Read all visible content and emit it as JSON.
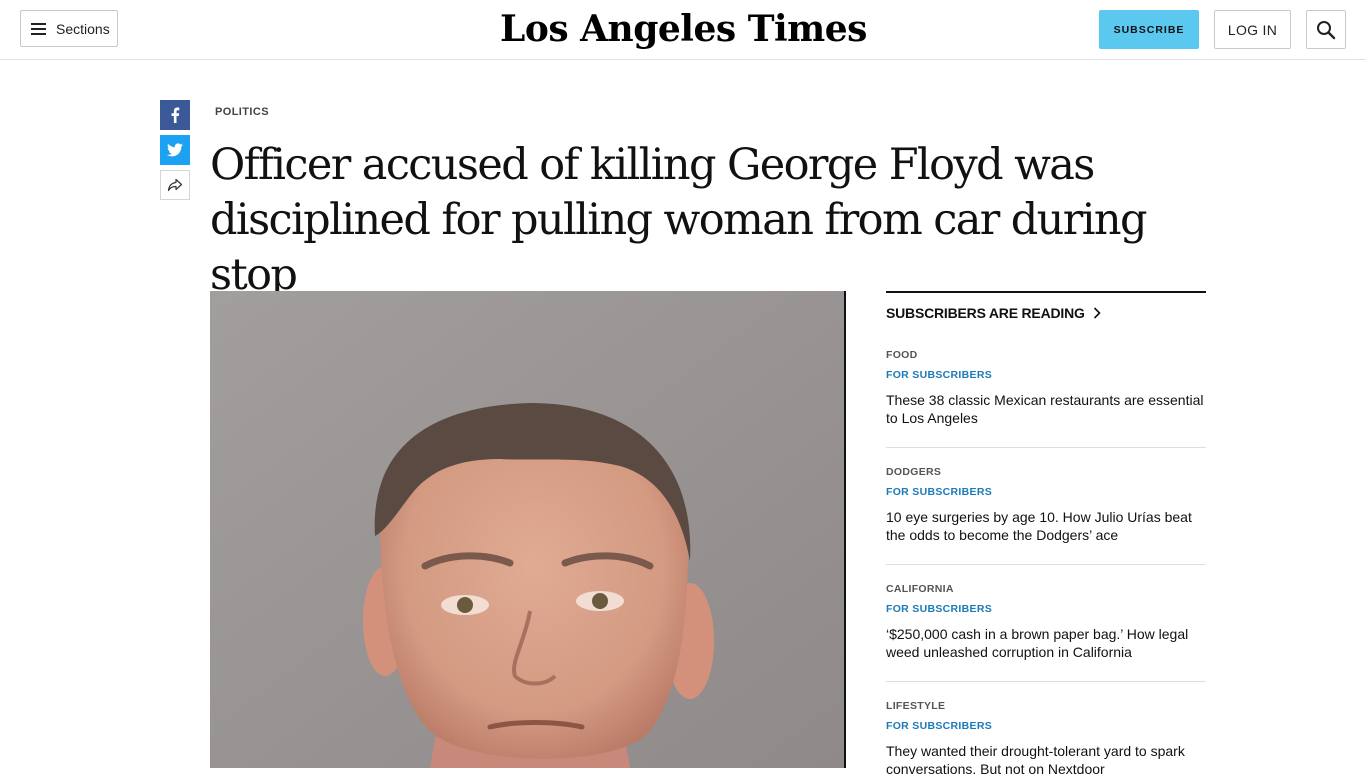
{
  "header": {
    "sections_label": "Sections",
    "logo": "Los Angeles Times",
    "subscribe_label": "SUBSCRIBE",
    "login_label": "LOG IN"
  },
  "icons": {
    "menu": "menu-icon",
    "search": "search-icon",
    "facebook": "facebook-icon",
    "twitter": "twitter-icon",
    "share": "share-icon",
    "chevron": "chevron-right-icon"
  },
  "article": {
    "kicker": "POLITICS",
    "headline": "Officer accused of killing George Floyd was disciplined for pulling woman from car during stop"
  },
  "sidebar": {
    "title": "SUBSCRIBERS ARE READING",
    "items": [
      {
        "category": "FOOD",
        "badge": "FOR SUBSCRIBERS",
        "title": "These 38 classic Mexican restaurants are essential to Los Angeles"
      },
      {
        "category": "DODGERS",
        "badge": "FOR SUBSCRIBERS",
        "title": "10 eye surgeries by age 10. How Julio Urías beat the odds to become the Dodgers’ ace"
      },
      {
        "category": "CALIFORNIA",
        "badge": "FOR SUBSCRIBERS",
        "title": "‘$250,000 cash in a brown paper bag.’ How legal weed unleashed corruption in California"
      },
      {
        "category": "LIFESTYLE",
        "badge": "FOR SUBSCRIBERS",
        "title": "They wanted their drought-tolerant yard to spark conversations. But not on Nextdoor"
      }
    ]
  },
  "colors": {
    "subscribe": "#5bc8f0",
    "facebook": "#3b5998",
    "twitter": "#1da1f2",
    "badge": "#1b7ab8"
  }
}
